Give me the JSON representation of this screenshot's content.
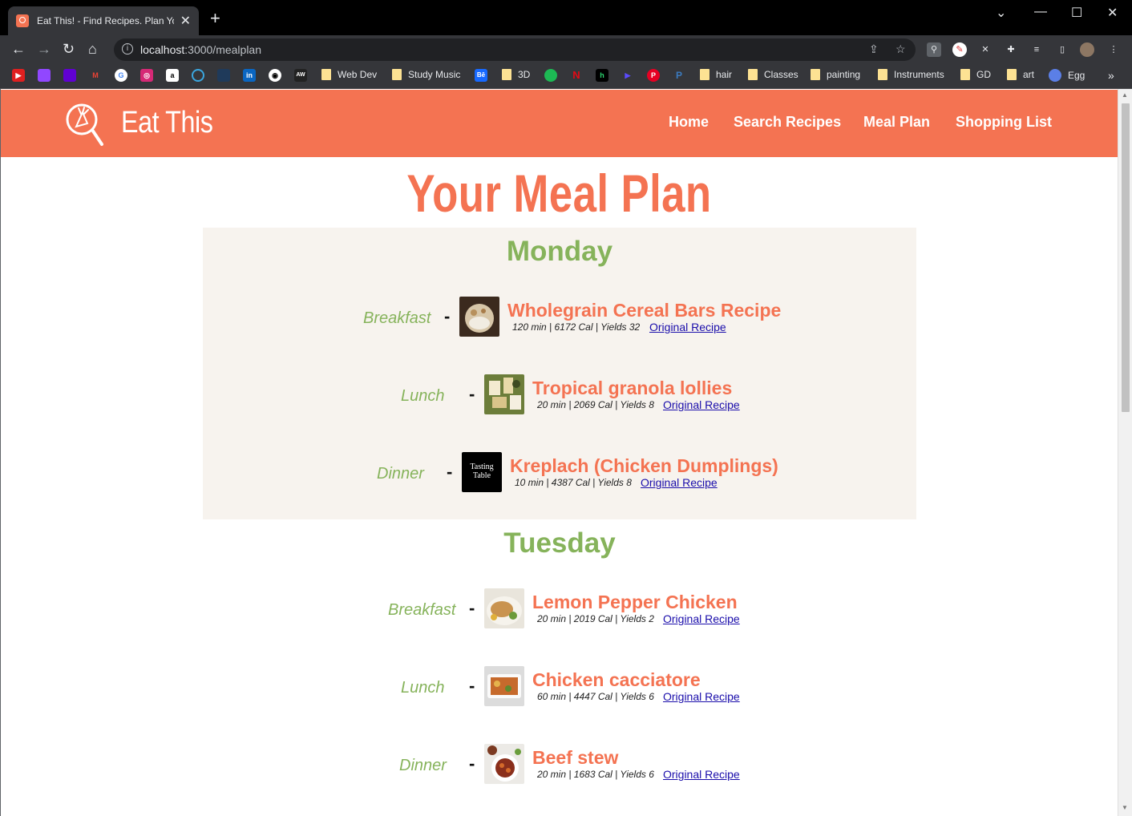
{
  "browser": {
    "tab_title": "Eat This! - Find Recipes. Plan Your",
    "url_host": "localhost",
    "url_path": ":3000/mealplan",
    "bookmarks": [
      {
        "label": "Web Dev"
      },
      {
        "label": "Study Music"
      },
      {
        "label": "3D"
      },
      {
        "label": "hair"
      },
      {
        "label": "Classes"
      },
      {
        "label": "painting"
      },
      {
        "label": "Instruments"
      },
      {
        "label": "GD"
      },
      {
        "label": "art"
      },
      {
        "label": "Egg"
      }
    ],
    "bookmark_overflow": "»"
  },
  "site": {
    "brand": "Eat This",
    "nav": [
      "Home",
      "Search Recipes",
      "Meal Plan",
      "Shopping List"
    ],
    "brand_color": "#f47352",
    "accent_color": "#86b35b"
  },
  "page": {
    "title": "Your Meal Plan",
    "link_label": "Original Recipe",
    "days": [
      {
        "name": "Monday",
        "meals": [
          {
            "type": "Breakfast",
            "title": "Wholegrain Cereal Bars Recipe",
            "meta": "120 min | 6172 Cal | Yields 32"
          },
          {
            "type": "Lunch",
            "title": "Tropical granola lollies",
            "meta": "20 min | 2069 Cal | Yields 8"
          },
          {
            "type": "Dinner",
            "title": "Kreplach (Chicken Dumplings)",
            "meta": "10 min | 4387 Cal | Yields 8",
            "thumb_text": "Tasting Table"
          }
        ]
      },
      {
        "name": "Tuesday",
        "meals": [
          {
            "type": "Breakfast",
            "title": "Lemon Pepper Chicken",
            "meta": "20 min | 2019 Cal | Yields 2"
          },
          {
            "type": "Lunch",
            "title": "Chicken cacciatore",
            "meta": "60 min | 4447 Cal | Yields 6"
          },
          {
            "type": "Dinner",
            "title": "Beef stew",
            "meta": "20 min | 1683 Cal | Yields 6"
          }
        ]
      }
    ]
  }
}
